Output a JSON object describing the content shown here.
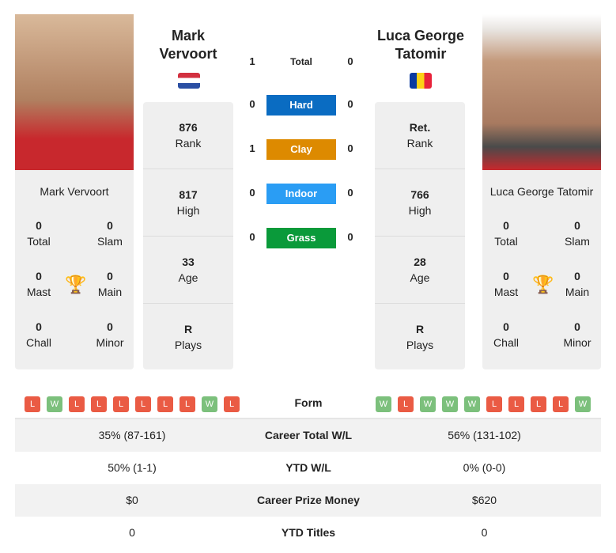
{
  "players": [
    {
      "name": "Mark Vervoort",
      "title_line1": "Mark",
      "title_line2": "Vervoort",
      "flag": "netherlands",
      "rank": "876",
      "rank_label": "Rank",
      "high": "817",
      "high_label": "High",
      "age": "33",
      "age_label": "Age",
      "plays": "R",
      "plays_label": "Plays",
      "total": "0",
      "total_label": "Total",
      "slam": "0",
      "slam_label": "Slam",
      "mast": "0",
      "mast_label": "Mast",
      "main": "0",
      "main_label": "Main",
      "chall": "0",
      "chall_label": "Chall",
      "minor": "0",
      "minor_label": "Minor",
      "form": [
        "L",
        "W",
        "L",
        "L",
        "L",
        "L",
        "L",
        "L",
        "W",
        "L"
      ]
    },
    {
      "name": "Luca George Tatomir",
      "title_line1": "Luca George",
      "title_line2": "Tatomir",
      "flag": "romania",
      "rank": "Ret.",
      "rank_label": "Rank",
      "high": "766",
      "high_label": "High",
      "age": "28",
      "age_label": "Age",
      "plays": "R",
      "plays_label": "Plays",
      "total": "0",
      "total_label": "Total",
      "slam": "0",
      "slam_label": "Slam",
      "mast": "0",
      "mast_label": "Mast",
      "main": "0",
      "main_label": "Main",
      "chall": "0",
      "chall_label": "Chall",
      "minor": "0",
      "minor_label": "Minor",
      "form": [
        "W",
        "L",
        "W",
        "W",
        "W",
        "L",
        "L",
        "L",
        "L",
        "W"
      ]
    }
  ],
  "h2h": [
    {
      "label": "Total",
      "left": "1",
      "right": "0"
    },
    {
      "label": "Hard",
      "left": "0",
      "right": "0",
      "color": "#0a6cc2"
    },
    {
      "label": "Clay",
      "left": "1",
      "right": "0",
      "color": "#dd8a00"
    },
    {
      "label": "Indoor",
      "left": "0",
      "right": "0",
      "color": "#2a9df4"
    },
    {
      "label": "Grass",
      "left": "0",
      "right": "0",
      "color": "#0a9a3a"
    }
  ],
  "colors": {
    "win": "#7cc07c",
    "loss": "#ea5b44"
  },
  "table": {
    "form_label": "Form",
    "rows": [
      {
        "label": "Career Total W/L",
        "left": "35% (87-161)",
        "right": "56% (131-102)"
      },
      {
        "label": "YTD W/L",
        "left": "50% (1-1)",
        "right": "0% (0-0)"
      },
      {
        "label": "Career Prize Money",
        "left": "$0",
        "right": "$620"
      },
      {
        "label": "YTD Titles",
        "left": "0",
        "right": "0"
      }
    ]
  }
}
